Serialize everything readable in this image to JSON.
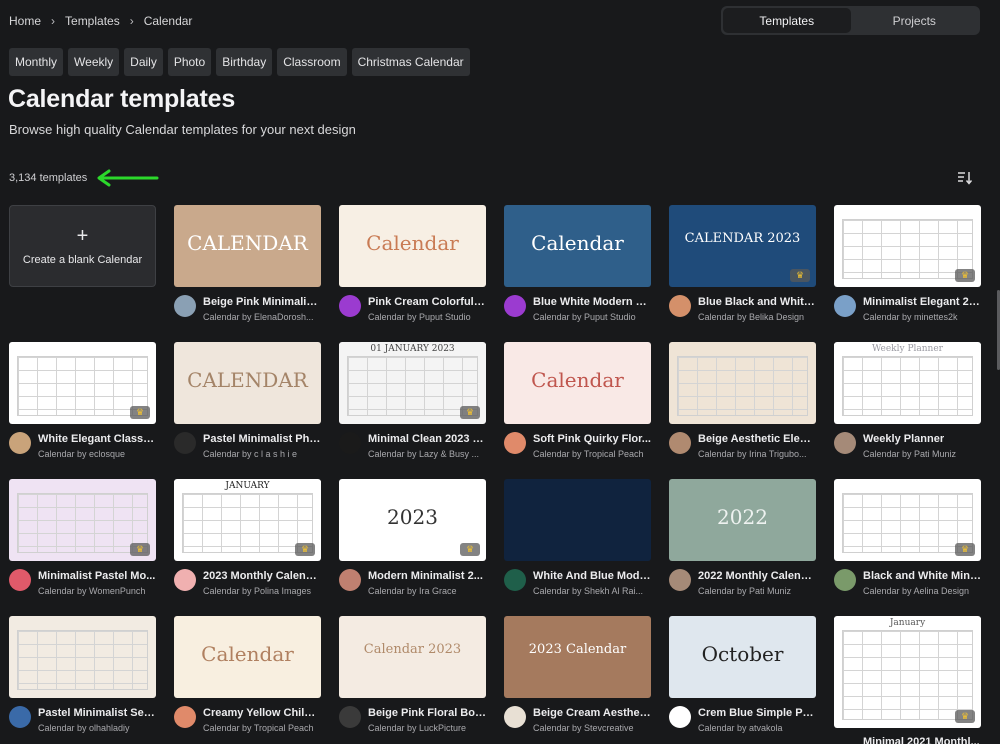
{
  "breadcrumb": {
    "items": [
      "Home",
      "Templates",
      "Calendar"
    ],
    "separator": "›"
  },
  "view_toggle": {
    "templates": "Templates",
    "projects": "Projects",
    "active": "Templates"
  },
  "chips": [
    "Monthly",
    "Weekly",
    "Daily",
    "Photo",
    "Birthday",
    "Classroom",
    "Christmas Calendar"
  ],
  "page": {
    "title": "Calendar templates",
    "subtitle": "Browse high quality Calendar templates for your next design",
    "count": "3,134 templates"
  },
  "annotation": {
    "arrow_color": "#2bd82b"
  },
  "blank_card": {
    "plus": "+",
    "label": "Create a blank Calendar"
  },
  "templates": [
    {
      "title": "Beige Pink Minimalist...",
      "author": "Calendar by ElenaDorosh...",
      "thumb_text": "CALENDAR",
      "bg": "#c9a98c",
      "fg": "#ffffff",
      "avatar_color": "#8aa0b4",
      "premium": false
    },
    {
      "title": "Pink Cream Colorful I...",
      "author": "Calendar by Puput Studio",
      "thumb_text": "Calendar",
      "bg": "#f7efe4",
      "fg": "#c97b54",
      "avatar_color": "#9b3bd0",
      "premium": false
    },
    {
      "title": "Blue White Modern Si...",
      "author": "Calendar by Puput Studio",
      "thumb_text": "Calendar",
      "bg": "#2f5f8a",
      "fg": "#ffffff",
      "avatar_color": "#9b3bd0",
      "premium": false
    },
    {
      "title": "Blue Black and White ...",
      "author": "Calendar by Belika Design",
      "thumb_text": "CALENDAR 2023",
      "bg": "#1f4b7a",
      "fg": "#ffffff",
      "avatar_color": "#d4906a",
      "premium": true
    },
    {
      "title": "Minimalist Elegant 20...",
      "author": "Calendar by minettes2k",
      "thumb_text": "",
      "bg": "#ffffff",
      "fg": "#555555",
      "avatar_color": "#7aa0c8",
      "premium": true,
      "grid": true
    },
    {
      "title": "White Elegant Classic...",
      "author": "Calendar by eclosque",
      "thumb_text": "",
      "bg": "#ffffff",
      "fg": "#555555",
      "avatar_color": "#c9a37a",
      "premium": true,
      "grid": true
    },
    {
      "title": "Pastel Minimalist Pho...",
      "author": "Calendar by c l a s h i e",
      "thumb_text": "CALENDAR",
      "bg": "#efe6dc",
      "fg": "#a48468",
      "avatar_color": "#2a2a2a",
      "premium": false
    },
    {
      "title": "Minimal Clean 2023 C...",
      "author": "Calendar by Lazy & Busy ...",
      "thumb_text": "01   JANUARY   2023",
      "bg": "#f4f4f4",
      "fg": "#444444",
      "avatar_color": "#1a1a1a",
      "premium": true,
      "grid": true
    },
    {
      "title": "Soft Pink Quirky Flor...",
      "author": "Calendar by Tropical Peach",
      "thumb_text": "Calendar",
      "bg": "#f9e9e6",
      "fg": "#c0564e",
      "avatar_color": "#e08a6a",
      "premium": false
    },
    {
      "title": "Beige Aesthetic Elega...",
      "author": "Calendar by Irina Trigubo...",
      "thumb_text": "",
      "bg": "#efe4d6",
      "fg": "#8a6a50",
      "avatar_color": "#b08a70",
      "premium": false,
      "grid": true
    },
    {
      "title": "Weekly Planner",
      "author": "Calendar by Pati Muniz",
      "thumb_text": "Weekly Planner",
      "bg": "#ffffff",
      "fg": "#9a9aa2",
      "avatar_color": "#a58a78",
      "premium": false,
      "grid": true
    },
    {
      "title": "Minimalist Pastel Mo...",
      "author": "Calendar by WomenPunch",
      "thumb_text": "",
      "bg": "#efe3f3",
      "fg": "#7a5a8a",
      "avatar_color": "#e05a6a",
      "premium": true,
      "grid": true
    },
    {
      "title": "2023 Monthly Calend...",
      "author": "Calendar by Polina Images",
      "thumb_text": "JANUARY",
      "bg": "#ffffff",
      "fg": "#222222",
      "avatar_color": "#f0b0b0",
      "premium": true,
      "grid": true
    },
    {
      "title": "Modern Minimalist 2...",
      "author": "Calendar by Ira Grace",
      "thumb_text": "2023",
      "bg": "#ffffff",
      "fg": "#333333",
      "avatar_color": "#c08070",
      "premium": true
    },
    {
      "title": "White And Blue Mode...",
      "author": "Calendar by Shekh Al Rai...",
      "thumb_text": "",
      "bg": "#10233e",
      "fg": "#c8d4e4",
      "avatar_color": "#1f5f4a",
      "premium": false
    },
    {
      "title": "2022 Monthly Calend...",
      "author": "Calendar by Pati Muniz",
      "thumb_text": "2022",
      "bg": "#8fa89c",
      "fg": "#eef2f0",
      "avatar_color": "#a58a78",
      "premium": false
    },
    {
      "title": "Black and White Mini...",
      "author": "Calendar by Aelina Design",
      "thumb_text": "",
      "bg": "#ffffff",
      "fg": "#444444",
      "avatar_color": "#7a9a6a",
      "premium": true,
      "grid": true
    },
    {
      "title": "Pastel Minimalist Sep...",
      "author": "Calendar by olhahladiy",
      "thumb_text": "",
      "bg": "#f2ebe2",
      "fg": "#9a8070",
      "avatar_color": "#3a6aa8",
      "premium": false,
      "grid": true
    },
    {
      "title": "Creamy Yellow Childi...",
      "author": "Calendar by Tropical Peach",
      "thumb_text": "Calendar",
      "bg": "#f8efe0",
      "fg": "#b08060",
      "avatar_color": "#e08a6a",
      "premium": false
    },
    {
      "title": "Beige Pink Floral Boh...",
      "author": "Calendar by LuckPicture",
      "thumb_text": "Calendar 2023",
      "bg": "#f4ebe2",
      "fg": "#b08a6a",
      "avatar_color": "#3a3a3a",
      "premium": false
    },
    {
      "title": "Beige Cream Aestheti...",
      "author": "Calendar by Stevcreative",
      "thumb_text": "2023 Calendar",
      "bg": "#a57a5e",
      "fg": "#ffffff",
      "avatar_color": "#e8e0d4",
      "premium": false
    },
    {
      "title": "Crem Blue Simple Ph...",
      "author": "Calendar by atvakola",
      "thumb_text": "October",
      "bg": "#dfe7ee",
      "fg": "#222222",
      "avatar_color": "#ffffff",
      "premium": false
    },
    {
      "title": "Minimal 2021 Monthl...",
      "author": "",
      "thumb_text": "January",
      "bg": "#ffffff",
      "fg": "#555555",
      "avatar_color": "",
      "premium": true,
      "grid": true
    }
  ]
}
